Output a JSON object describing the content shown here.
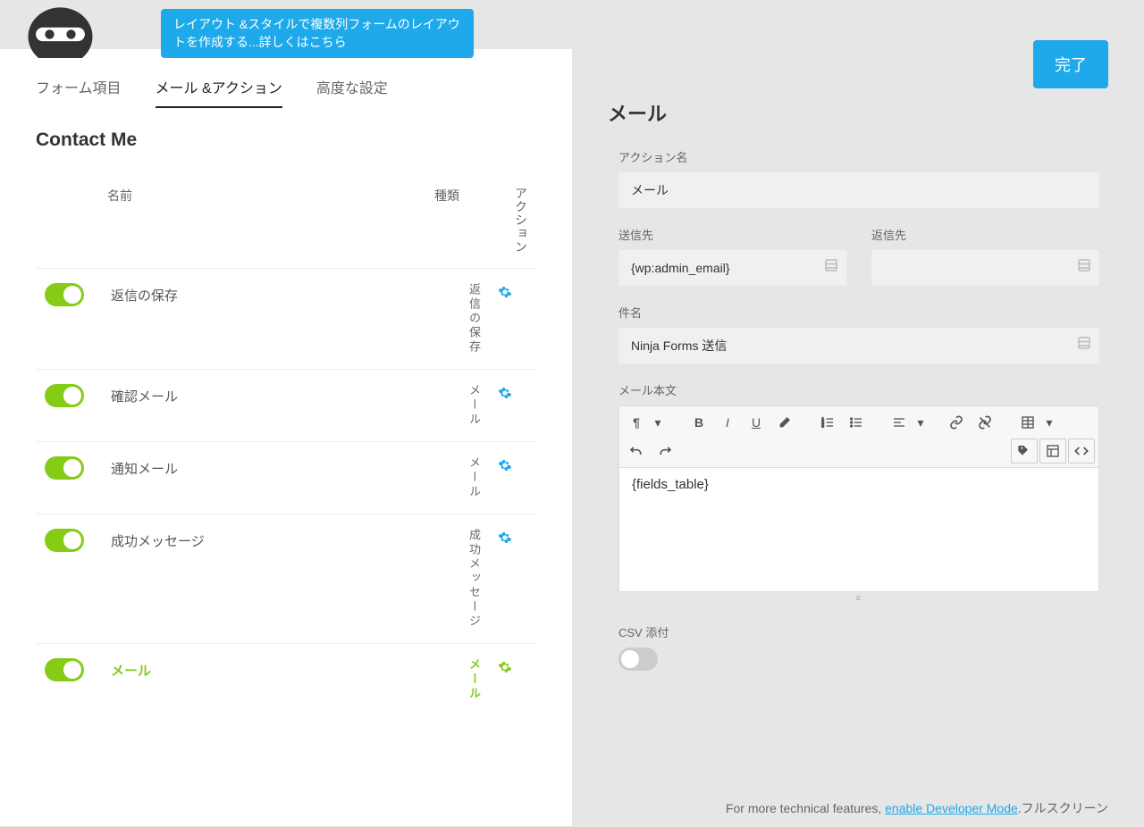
{
  "tooltip": "レイアウト &スタイルで複数列フォームのレイアウトを作成する...詳しくはこちら",
  "done_button": "完了",
  "tabs": {
    "fields": "フォーム項目",
    "actions": "メール &アクション",
    "advanced": "高度な設定"
  },
  "form_title": "Contact Me",
  "columns": {
    "name": "名前",
    "type": "種類",
    "action": "アクション"
  },
  "rows": [
    {
      "name": "返信の保存",
      "type": "返信の保存",
      "active": false
    },
    {
      "name": "確認メール",
      "type": "メール",
      "active": false
    },
    {
      "name": "通知メール",
      "type": "メール",
      "active": false
    },
    {
      "name": "成功メッセージ",
      "type": "成功メッセージ",
      "active": false
    },
    {
      "name": "メール",
      "type": "メール",
      "active": true
    }
  ],
  "panel": {
    "title": "メール",
    "action_name_label": "アクション名",
    "action_name_value": "メール",
    "to_label": "送信先",
    "to_value": "{wp:admin_email}",
    "reply_label": "返信先",
    "reply_value": "",
    "subject_label": "件名",
    "subject_value": "Ninja Forms 送信",
    "body_label": "メール本文",
    "body_value": "{fields_table}",
    "csv_label": "CSV 添付"
  },
  "footer": {
    "text": "For more technical features, ",
    "link": "enable Developer Mode",
    "after": ".フルスクリーン"
  }
}
